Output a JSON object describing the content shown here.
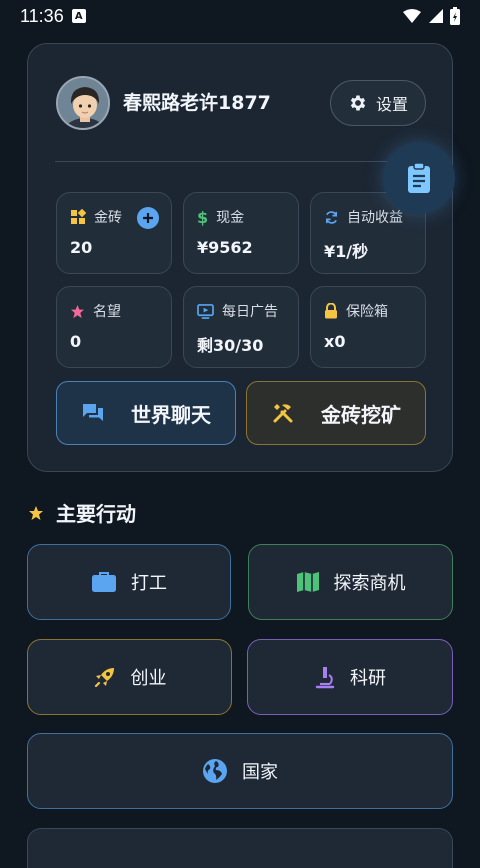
{
  "status": {
    "time": "11:36"
  },
  "profile": {
    "username": "春熙路老许1877",
    "settings_label": "设置"
  },
  "stats": [
    {
      "label": "金砖",
      "value": "20"
    },
    {
      "label": "现金",
      "value": "¥9562"
    },
    {
      "label": "自动收益",
      "value": "¥1/秒"
    },
    {
      "label": "名望",
      "value": "0"
    },
    {
      "label": "每日广告",
      "value": "剩30/30"
    },
    {
      "label": "保险箱",
      "value": "x0"
    }
  ],
  "buttons": {
    "world_chat": "世界聊天",
    "gold_mining": "金砖挖矿"
  },
  "main_actions": {
    "title": "主要行动",
    "items": [
      "打工",
      "探索商机",
      "创业",
      "科研",
      "国家"
    ]
  },
  "colors": {
    "accent_blue": "#5aa4f0",
    "accent_yellow": "#f5c542",
    "accent_green": "#4fc27a",
    "accent_purple": "#a77ff0"
  }
}
